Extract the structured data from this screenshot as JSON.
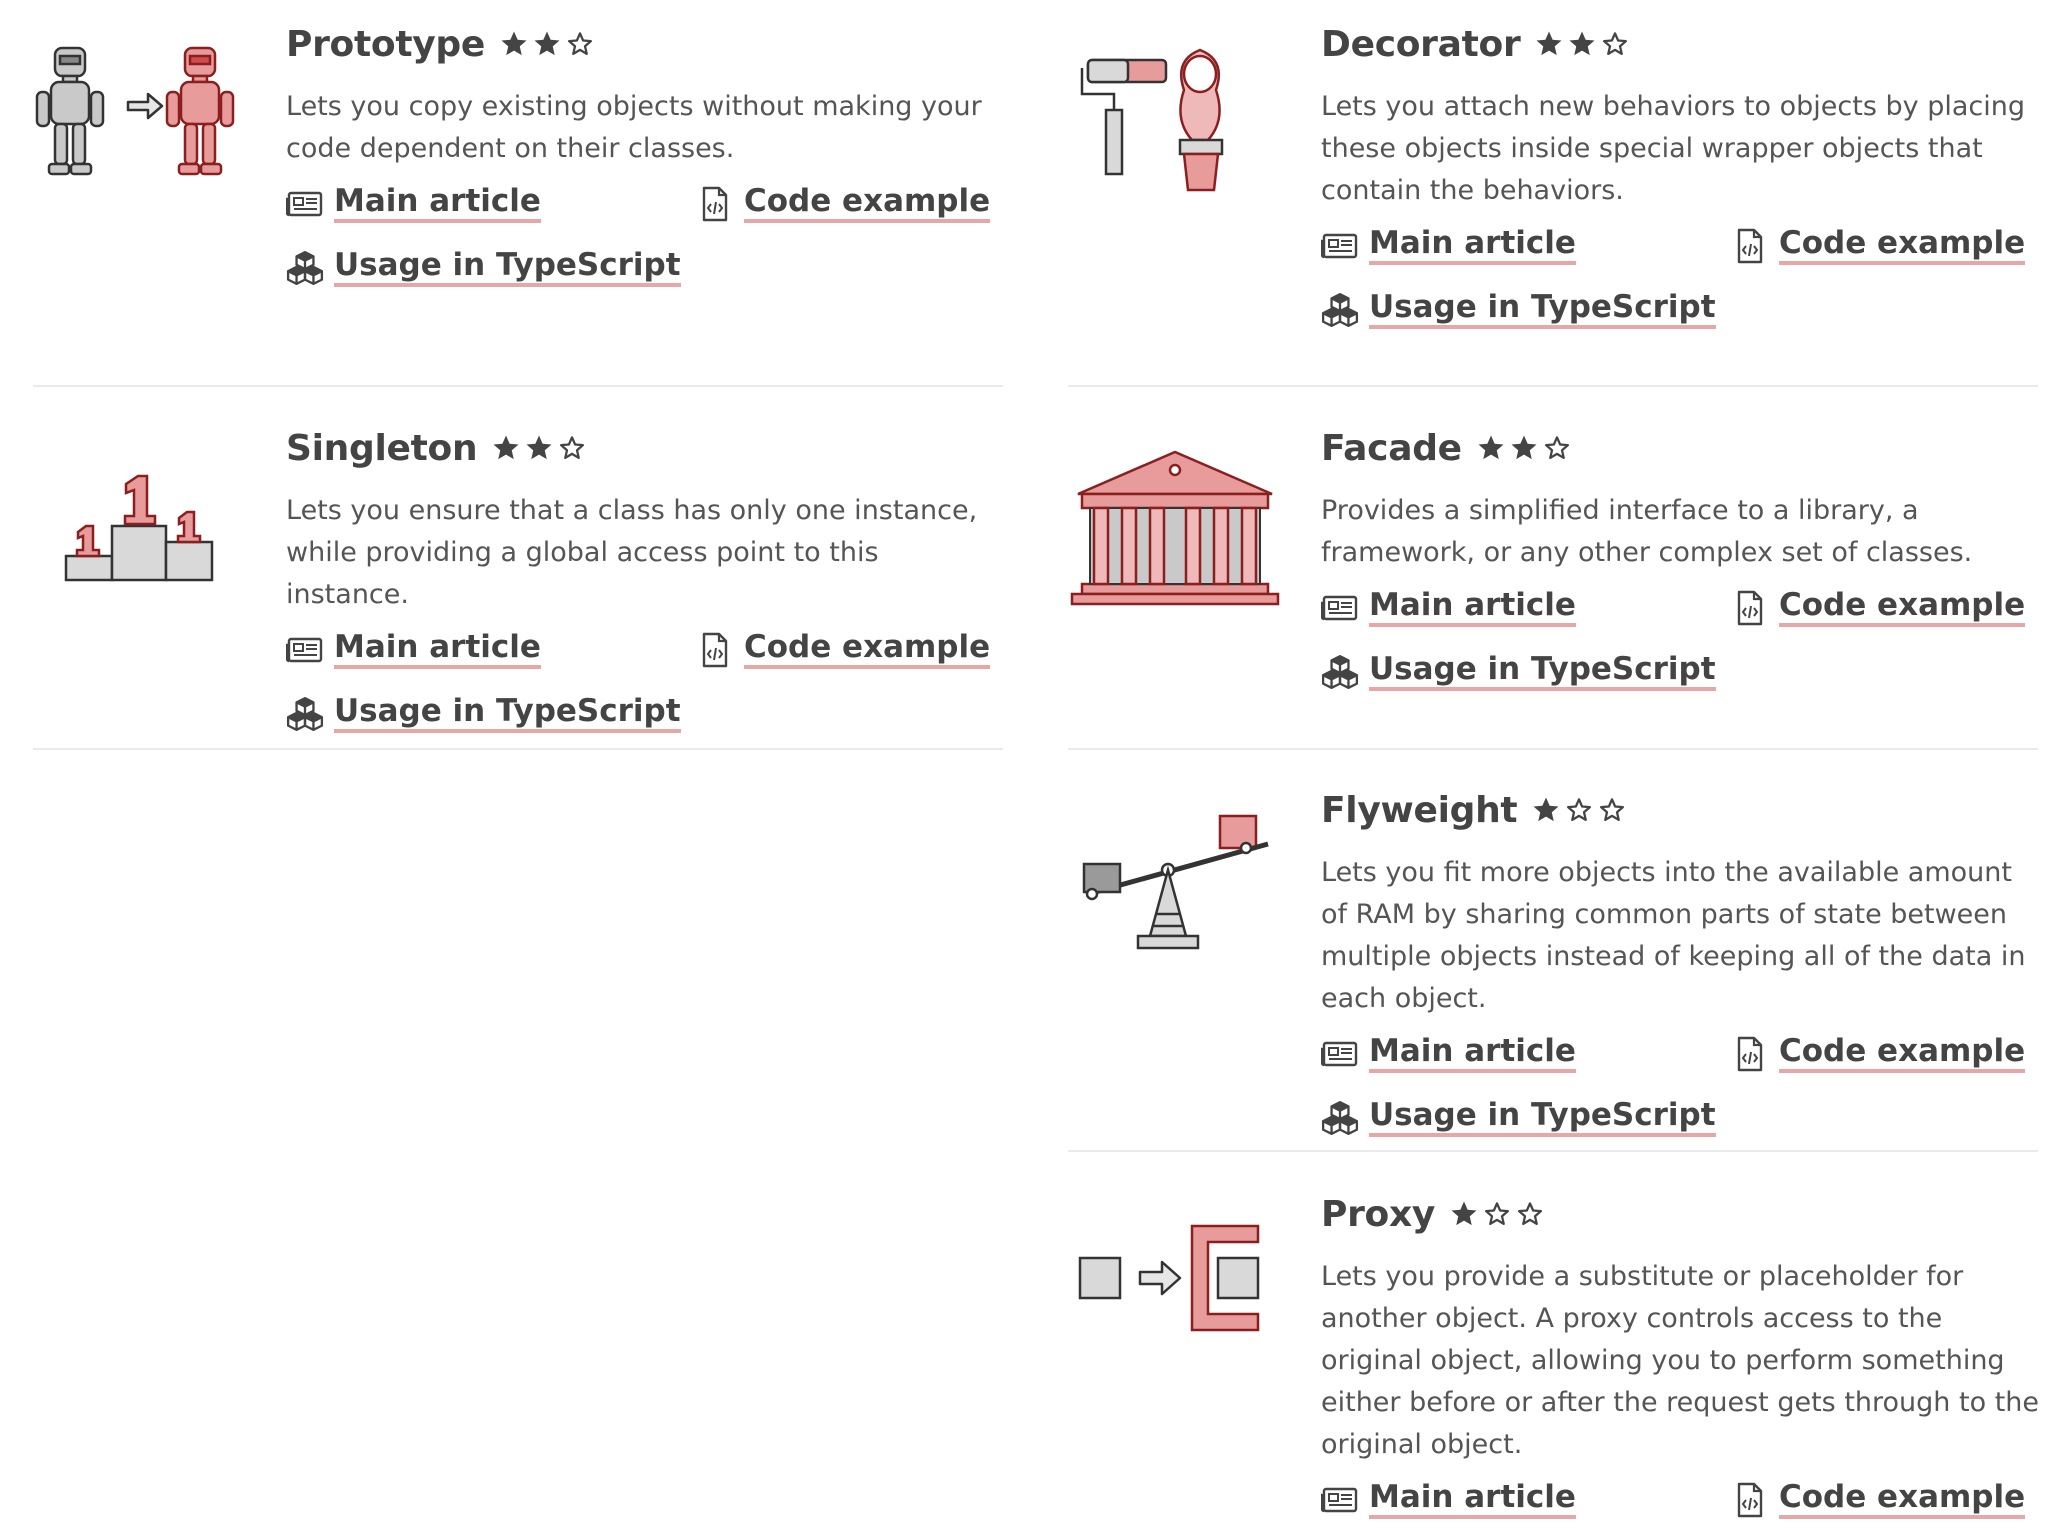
{
  "left_column": [
    {
      "title": "Prototype",
      "rating": 2,
      "icon": "prototype-robots-illustration",
      "description": "Lets you copy existing objects without making your code dependent on their classes.",
      "links": {
        "main": "Main article",
        "code": "Code example",
        "usage": "Usage in TypeScript"
      }
    },
    {
      "title": "Singleton",
      "rating": 2,
      "icon": "singleton-podium-illustration",
      "description": "Lets you ensure that a class has only one instance, while providing a global access point to this instance.",
      "links": {
        "main": "Main article",
        "code": "Code example",
        "usage": "Usage in TypeScript"
      }
    }
  ],
  "right_column": [
    {
      "title": "Decorator",
      "rating": 2,
      "icon": "decorator-roller-doll-illustration",
      "description": "Lets you attach new behaviors to objects by placing these objects inside special wrapper objects that contain the behaviors.",
      "links": {
        "main": "Main article",
        "code": "Code example",
        "usage": "Usage in TypeScript"
      }
    },
    {
      "title": "Facade",
      "rating": 2,
      "icon": "facade-building-illustration",
      "description": "Provides a simplified interface to a library, a framework, or any other complex set of classes.",
      "links": {
        "main": "Main article",
        "code": "Code example",
        "usage": "Usage in TypeScript"
      }
    },
    {
      "title": "Flyweight",
      "rating": 1,
      "icon": "flyweight-seesaw-illustration",
      "description": "Lets you fit more objects into the available amount of RAM by sharing common parts of state between multiple objects instead of keeping all of the data in each object.",
      "links": {
        "main": "Main article",
        "code": "Code example",
        "usage": "Usage in TypeScript"
      }
    },
    {
      "title": "Proxy",
      "rating": 1,
      "icon": "proxy-box-illustration",
      "description": "Lets you provide a substitute or placeholder for another object. A proxy controls access to the original object, allowing you to perform something either before or after the request gets through to the original object.",
      "links": {
        "main": "Main article",
        "code": "Code example"
      }
    }
  ],
  "colors": {
    "accent": "#e7a7a7",
    "illustration_red": "#d04b4b",
    "text": "#444444",
    "separator": "#eaeaea"
  }
}
